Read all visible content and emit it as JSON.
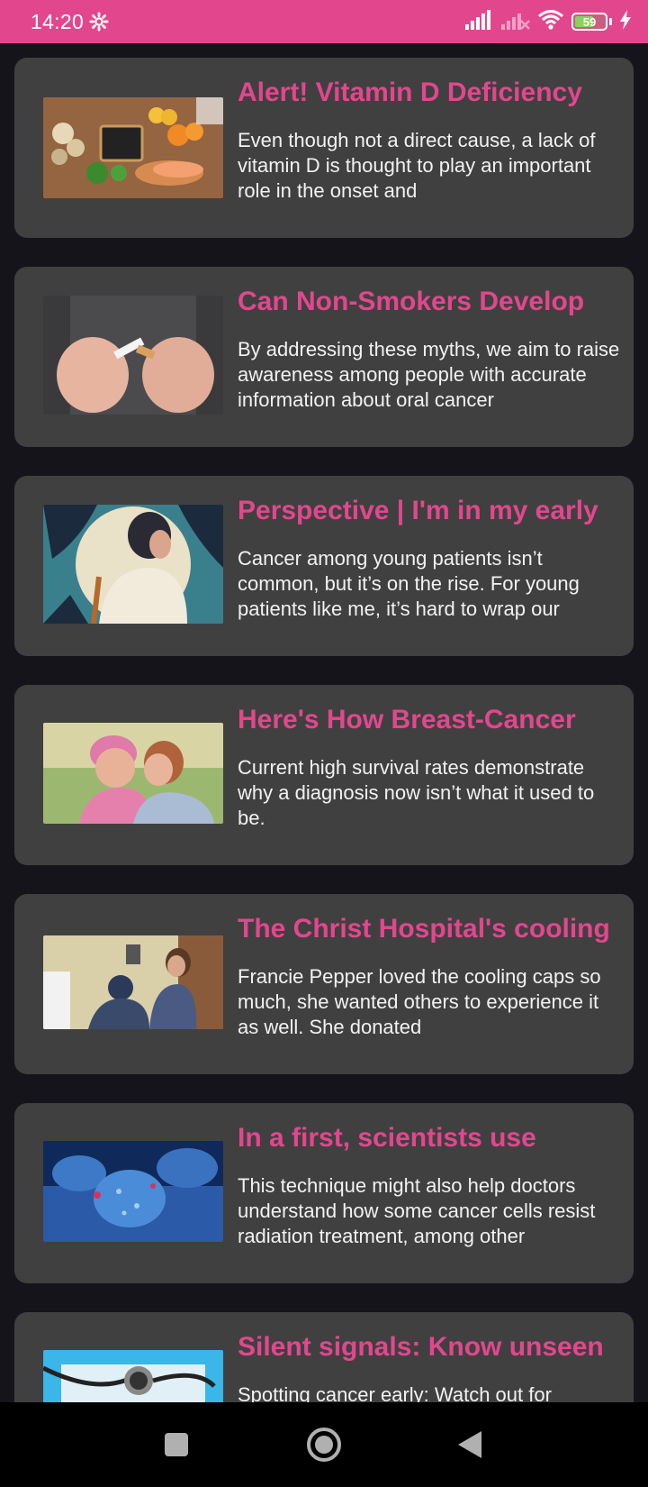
{
  "status_bar": {
    "time": "14:20",
    "battery_level": "59",
    "battery_percent": 59,
    "icons": [
      "gear-icon",
      "signal-icon",
      "signal-off-icon",
      "wifi-icon",
      "battery-icon",
      "charging-icon"
    ]
  },
  "colors": {
    "accent": "#e2478e",
    "card_background": "#404040",
    "page_background": "#16141b"
  },
  "articles": [
    {
      "title": "Alert! Vitamin D Deficiency",
      "summary": "Even though not a direct cause, a lack of vitamin D is thought to play an important role in the onset and",
      "image": "vitamin-d-food-image"
    },
    {
      "title": "Can Non-Smokers Develop",
      "summary": "By addressing these myths, we aim to raise awareness among people with accurate information about oral cancer",
      "image": "broken-cigarette-image"
    },
    {
      "title": "Perspective | I'm in my early",
      "summary": "Cancer among young patients isn’t common, but it’s on the rise. For young patients like me, it’s hard to wrap our",
      "image": "woman-illustration-image"
    },
    {
      "title": "Here's How Breast-Cancer",
      "summary": "Current high survival rates demonstrate why a diagnosis now isn’t what it used to be.",
      "image": "survivor-hug-image"
    },
    {
      "title": "The Christ Hospital's cooling",
      "summary": "Francie Pepper loved the cooling caps so much, she wanted others to experience it as well. She donated",
      "image": "hospital-cooling-cap-image"
    },
    {
      "title": "In a first, scientists use",
      "summary": "This technique might also help doctors understand how some cancer cells resist radiation treatment, among other",
      "image": "cancer-cell-image"
    },
    {
      "title": "Silent signals: Know unseen",
      "summary": "Spotting cancer early: Watch out for",
      "image": "stethoscope-image"
    }
  ],
  "nav_bar": {
    "buttons": [
      "recents-button",
      "home-button",
      "back-button"
    ]
  }
}
